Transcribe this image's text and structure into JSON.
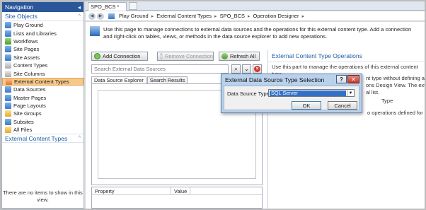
{
  "nav": {
    "header": "Navigation",
    "section1": "Site Objects",
    "items": [
      {
        "label": "Play Ground",
        "icon": "site-icon",
        "color": "blue"
      },
      {
        "label": "Lists and Libraries",
        "icon": "list-icon",
        "color": "blue"
      },
      {
        "label": "Workflows",
        "icon": "workflow-icon",
        "color": "green"
      },
      {
        "label": "Site Pages",
        "icon": "page-icon",
        "color": "blue"
      },
      {
        "label": "Site Assets",
        "icon": "asset-icon",
        "color": "blue"
      },
      {
        "label": "Content Types",
        "icon": "content-type-icon",
        "color": "grey"
      },
      {
        "label": "Site Columns",
        "icon": "column-icon",
        "color": "grey"
      },
      {
        "label": "External Content Types",
        "icon": "external-content-icon",
        "color": "orange",
        "selected": true
      },
      {
        "label": "Data Sources",
        "icon": "data-source-icon",
        "color": "blue"
      },
      {
        "label": "Master Pages",
        "icon": "master-page-icon",
        "color": "blue"
      },
      {
        "label": "Page Layouts",
        "icon": "layout-icon",
        "color": "blue"
      },
      {
        "label": "Site Groups",
        "icon": "group-icon",
        "color": "yellow"
      },
      {
        "label": "Subsites",
        "icon": "subsite-icon",
        "color": "blue"
      },
      {
        "label": "All Files",
        "icon": "files-icon",
        "color": "yellow"
      }
    ],
    "section2": "External Content Types",
    "empty_message": "There are no items to show in this view."
  },
  "tabbar": {
    "tab_label": "SPO_BCS *"
  },
  "breadcrumb": [
    "Play Ground",
    "External Content Types",
    "SPO_BCS",
    "Operation Designer"
  ],
  "content": {
    "description": "Use this page to manage connections to external data sources and the operations for this external content type. Add a connection and right-click on tables, views, or methods in the data source explorer to add new operations.",
    "buttons": {
      "add_connection": "Add Connection",
      "remove_connection": "Remove Connection",
      "refresh_all": "Refresh All"
    },
    "search_placeholder": "Search External Data Sources",
    "explorer_tabs": [
      "Data Source Explorer",
      "Search Results"
    ],
    "properties_headers": [
      "Property",
      "Value"
    ]
  },
  "ops": {
    "title": "External Content Type Operations",
    "intro": "Use this part to manage the operations of this external content type.",
    "frag1": "nt type without defining at",
    "frag2": "ons Design View. The externa",
    "frag3": "al list.",
    "frag4": "Type",
    "frag5": "o operations defined for this"
  },
  "dialog": {
    "title": "External Data Source Type Selection",
    "field_label": "Data Source Type",
    "selected_value": "SQL Server",
    "ok": "OK",
    "cancel": "Cancel"
  }
}
